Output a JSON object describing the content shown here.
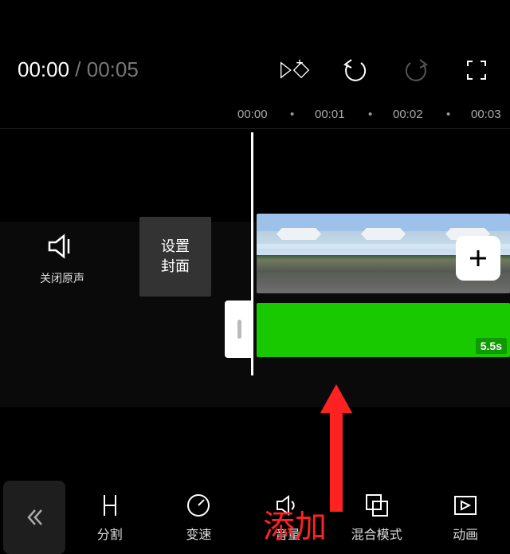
{
  "time": {
    "current": "00:00",
    "sep": " / ",
    "total": "00:05"
  },
  "ruler": {
    "ticks": [
      "00:00",
      "00:01",
      "00:02",
      "00:03"
    ]
  },
  "mute": {
    "label": "关闭原声"
  },
  "cover": {
    "line1": "设置",
    "line2": "封面"
  },
  "track2": {
    "badge": "5.5s"
  },
  "annotation": {
    "label": "添加"
  },
  "toolbar": {
    "items": [
      {
        "label": "分割",
        "icon": "split"
      },
      {
        "label": "变速",
        "icon": "speed"
      },
      {
        "label": "音量",
        "icon": "volume"
      },
      {
        "label": "混合模式",
        "icon": "blend"
      },
      {
        "label": "动画",
        "icon": "anim"
      }
    ]
  }
}
